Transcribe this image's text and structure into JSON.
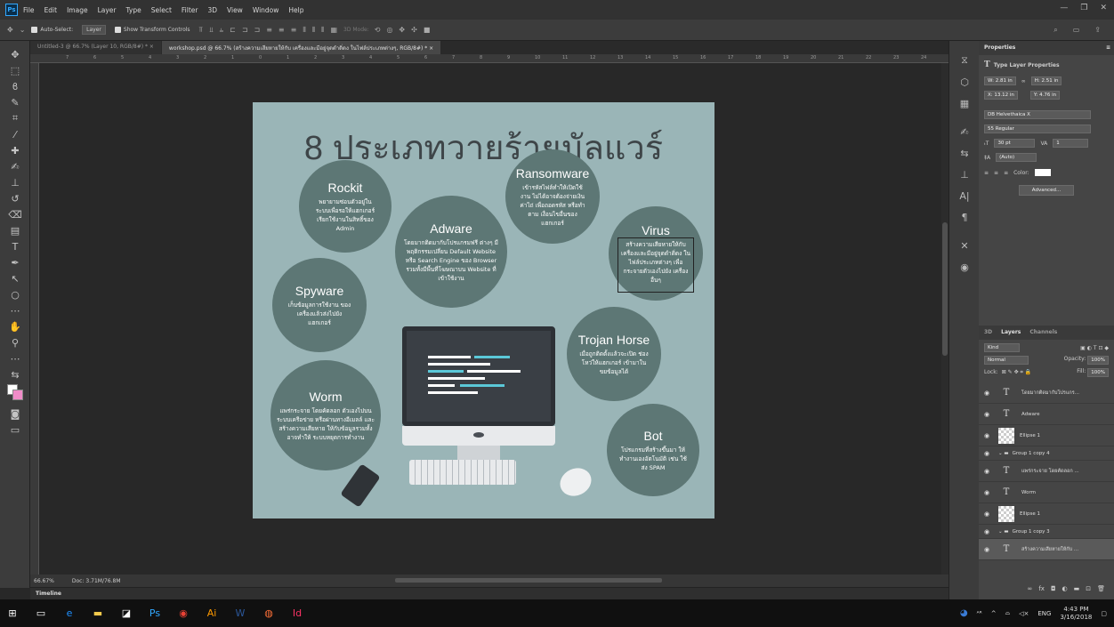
{
  "menu": [
    "File",
    "Edit",
    "Image",
    "Layer",
    "Type",
    "Select",
    "Filter",
    "3D",
    "View",
    "Window",
    "Help"
  ],
  "app_icon": "Ps",
  "options": {
    "auto_select": "Auto-Select:",
    "layer_select": "Layer",
    "show_transform": "Show Transform Controls",
    "mode_3d": "3D Mode:"
  },
  "tabs": [
    {
      "label": "Untitled-3 @ 66.7% (Layer 10, RGB/8#) *",
      "active": false
    },
    {
      "label": "workshop.psd @ 66.7% (สร้างความเสียหายให้กับ เครื่องและมีอยู่จุดดำดิ่ดง ในไฟล์ประเภทต่างๆ, RGB/8#) *",
      "active": true
    }
  ],
  "ruler_marks": [
    "7",
    "6",
    "5",
    "4",
    "3",
    "2",
    "1",
    "0",
    "1",
    "2",
    "3",
    "4",
    "5",
    "6",
    "7",
    "8",
    "9",
    "10",
    "11",
    "12",
    "13",
    "14",
    "15",
    "16",
    "17",
    "18",
    "19",
    "20",
    "21",
    "22",
    "23",
    "24"
  ],
  "status": {
    "zoom": "66.67%",
    "doc": "Doc: 3.71M/76.8M"
  },
  "timeline_label": "Timeline",
  "infographic": {
    "title": "8 ประเภทวายร้ายมัลแวร์",
    "circles": [
      {
        "title": "Rockit",
        "desc": "พยายามซ่อนตัวอยู่ใน ระบบเพื่อรอให้แฮกเกอร์ เรียกใช้งานในสิทธิ์ของ Admin"
      },
      {
        "title": "Ransomware",
        "desc": "เข้ารหัสไฟล์ทำให้เปิดใช้งาน ไม่ได้อาจต้องจ่ายเงินค่าไถ่ เพื่อถอดรหัส หรือทำตาม เงื่อนไขอื่นของแฮกเกอร์"
      },
      {
        "title": "Adware",
        "desc": "โดยมากติดมากับโปรแกรมฟรี ต่างๆ มีพฤติกรรมเปลี่ยน Default Website หรือ Search Engine ของ Browser รวมทั้งมีพื้นที่โฆษณาบน Website ที่เข้าใช้งาน"
      },
      {
        "title": "Virus",
        "desc": "สร้างความเสียหายให้กับ เครื่องและมีอยู่จุดดำดิ่ดง ในไฟล์ประเภทต่างๆ เพื่อ กระจายตัวเองไปยัง เครื่องอื่นๆ"
      },
      {
        "title": "Spyware",
        "desc": "เก็บข้อมูลการใช้งาน ของเครื่องแล้วส่งไปยัง แฮกเกอร์"
      },
      {
        "title": "Trojan Horse",
        "desc": "เมื่อถูกติดตั้งแล้วจะเปิด ช่องโหว่ให้แฮกเกอร์ เข้ามาในขยข้อมูลได้"
      },
      {
        "title": "Worm",
        "desc": "แพร่กระจาย โดยคัดลอก ตัวเองไปบนระบบเครือข่าย หรือผ่านทางอีเมลล์ และสร้างความเสียหาย ให้กับข้อมูลรวมทั้งอาจทำให้ ระบบหยุดการทำงาน"
      },
      {
        "title": "Bot",
        "desc": "โปรแกรมที่สร้างขึ้นมา ให้ทำงานเองอัตโนมัติ เช่น ใช้ส่ง SPAM"
      }
    ],
    "colors": {
      "bg": "#9ab5b7",
      "circle": "#5d7775",
      "title": "#3e4548",
      "accent": "#5bc8d8"
    }
  },
  "properties": {
    "tab": "Properties",
    "heading": "Type Layer Properties",
    "w": "W: 2.81 in",
    "h": "H: 2.51 in",
    "x": "X: 13.12 in",
    "y": "Y: 4.76 in",
    "font": "DB Helvethaica X",
    "style": "55 Regular",
    "size": "30 pt",
    "kerning": "1",
    "leading": "(Auto)",
    "color_label": "Color:",
    "advanced": "Advanced..."
  },
  "layers_panel": {
    "tabs": [
      "3D",
      "Layers",
      "Channels"
    ],
    "kind": "Kind",
    "blend": "Normal",
    "opacity_label": "Opacity:",
    "opacity": "100%",
    "lock_label": "Lock:",
    "fill_label": "Fill:",
    "fill": "100%",
    "layers": [
      {
        "type": "text",
        "name": "โดยมากติดมากับโปรแกร..."
      },
      {
        "type": "text",
        "name": "Adware"
      },
      {
        "type": "shape",
        "name": "Ellipse 1"
      },
      {
        "type": "group",
        "name": "Group 1 copy 4"
      },
      {
        "type": "text",
        "name": "แพร่กระจาย โดยคัดลอก ..."
      },
      {
        "type": "text",
        "name": "Worm"
      },
      {
        "type": "shape",
        "name": "Ellipse 1"
      },
      {
        "type": "group",
        "name": "Group 1 copy 3"
      },
      {
        "type": "text",
        "name": "สร้างความเสียหายให้กับ ..."
      }
    ]
  },
  "taskbar": {
    "time": "4:43 PM",
    "date": "3/16/2018",
    "lang": "ENG"
  }
}
